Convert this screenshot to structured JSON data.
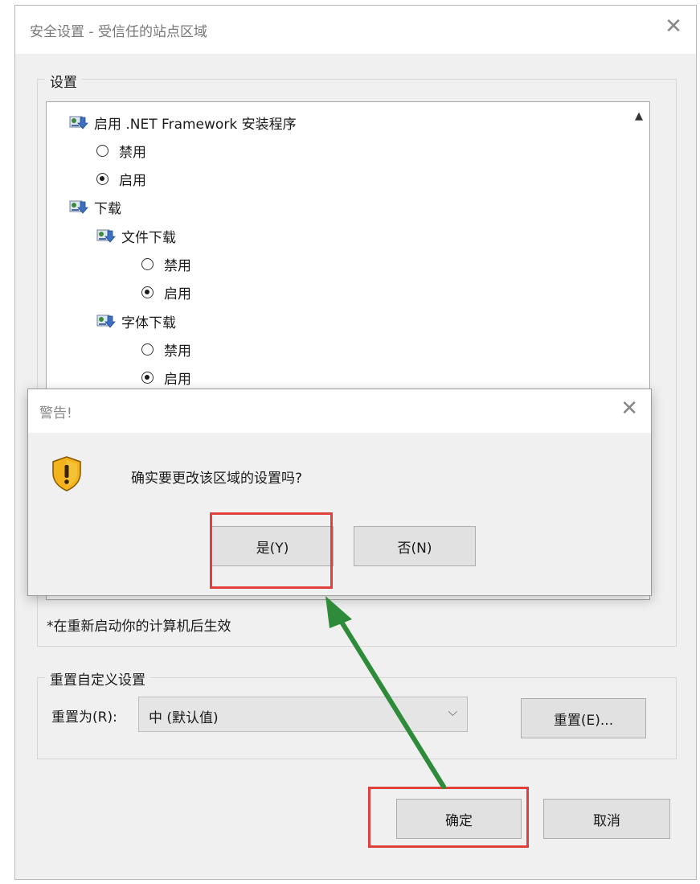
{
  "main_dialog": {
    "title": "安全设置 - 受信任的站点区域",
    "close_glyph": "✕",
    "settings_group_label": "设置",
    "tree": [
      {
        "type": "header",
        "label": "启用 .NET Framework 安装程序",
        "icon": "settings-node-icon"
      },
      {
        "type": "radio",
        "label": "禁用",
        "checked": false
      },
      {
        "type": "radio",
        "label": "启用",
        "checked": true
      },
      {
        "type": "header",
        "label": "下载",
        "icon": "settings-node-icon"
      },
      {
        "type": "subheader",
        "label": "文件下载",
        "icon": "settings-node-icon"
      },
      {
        "type": "radio",
        "label": "禁用",
        "checked": false
      },
      {
        "type": "radio",
        "label": "启用",
        "checked": true
      },
      {
        "type": "subheader",
        "label": "字体下载",
        "icon": "settings-node-icon"
      },
      {
        "type": "radio",
        "label": "禁用",
        "checked": false
      },
      {
        "type": "radio",
        "label": "启用",
        "checked": true
      }
    ],
    "scroll_up_glyph": "▲",
    "restart_note": "*在重新启动你的计算机后生效",
    "reset_group_label": "重置自定义设置",
    "reset_to_label": "重置为(R):",
    "reset_select_value": "中 (默认值)",
    "chevron_glyph": "⌵",
    "reset_button": "重置(E)...",
    "ok_button": "确定",
    "cancel_button": "取消"
  },
  "warning_dialog": {
    "title": "警告!",
    "close_glyph": "✕",
    "message": "确实要更改该区域的设置吗?",
    "icon": "warning-shield-icon",
    "yes_button": "是(Y)",
    "no_button": "否(N)"
  },
  "annotations": {
    "highlight_color": "#e0403b",
    "arrow_color": "#2e8b3a"
  }
}
